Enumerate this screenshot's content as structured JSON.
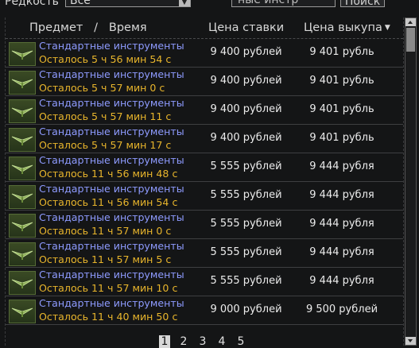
{
  "filters": {
    "rarity_label": "Редкость",
    "rarity_value": "Все",
    "search_value": "ные инстр",
    "search_button": "Поиск"
  },
  "columns": {
    "item": "Предмет   /   Время",
    "bid": "Цена ставки",
    "buyout": "Цена выкупа",
    "sort_icon": "▼"
  },
  "rows": [
    {
      "name": "Стандартные инструменты",
      "time": "Осталось 5 ч 56 мин 54 с",
      "bid": "9 400 рублей",
      "buyout": "9 401 рубль"
    },
    {
      "name": "Стандартные инструменты",
      "time": "Осталось 5 ч 57 мин 0 с",
      "bid": "9 400 рублей",
      "buyout": "9 401 рубль"
    },
    {
      "name": "Стандартные инструменты",
      "time": "Осталось 5 ч 57 мин 11 с",
      "bid": "9 400 рублей",
      "buyout": "9 401 рубль"
    },
    {
      "name": "Стандартные инструменты",
      "time": "Осталось 5 ч 57 мин 17 с",
      "bid": "9 400 рублей",
      "buyout": "9 401 рубль"
    },
    {
      "name": "Стандартные инструменты",
      "time": "Осталось 11 ч 56 мин 48 с",
      "bid": "5 555 рублей",
      "buyout": "9 444 рубля"
    },
    {
      "name": "Стандартные инструменты",
      "time": "Осталось 11 ч 56 мин 54 с",
      "bid": "5 555 рублей",
      "buyout": "9 444 рубля"
    },
    {
      "name": "Стандартные инструменты",
      "time": "Осталось 11 ч 57 мин 0 с",
      "bid": "5 555 рублей",
      "buyout": "9 444 рубля"
    },
    {
      "name": "Стандартные инструменты",
      "time": "Осталось 11 ч 57 мин 5 с",
      "bid": "5 555 рублей",
      "buyout": "9 444 рубля"
    },
    {
      "name": "Стандартные инструменты",
      "time": "Осталось 11 ч 57 мин 10 с",
      "bid": "5 555 рублей",
      "buyout": "9 444 рубля"
    },
    {
      "name": "Стандартные инструменты",
      "time": "Осталось 11 ч 40 мин 50 с",
      "bid": "9 000 рублей",
      "buyout": "9 500 рублей"
    }
  ],
  "pagination": {
    "pages": [
      "1",
      "2",
      "3",
      "4",
      "5"
    ],
    "active": "1"
  },
  "colors": {
    "item_name": "#8e9bff",
    "time_left": "#e8b52c",
    "background": "#141516"
  },
  "icons": {
    "item_thumbnail": "tools-icon",
    "rarity_dropdown": "chevron-down-icon",
    "sort": "sort-desc-icon"
  }
}
